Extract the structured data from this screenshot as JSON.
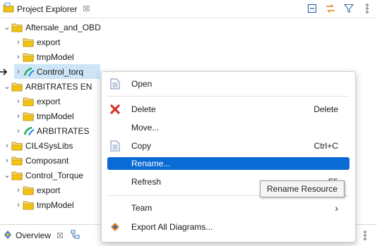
{
  "view": {
    "title": "Project Explorer",
    "close_glyph": "☒",
    "toolbar": [
      "collapse-all-icon",
      "link-with-editor-icon",
      "filter-icon",
      "view-menu-icon"
    ]
  },
  "tree": [
    {
      "label": "Aftersale_and_OBD",
      "level": 0,
      "expanded": true,
      "icon": "project-folder-icon"
    },
    {
      "label": "export",
      "level": 1,
      "expanded": false,
      "icon": "folder-icon"
    },
    {
      "label": "tmpModel",
      "level": 1,
      "expanded": false,
      "icon": "folder-icon"
    },
    {
      "label": "Control_torq",
      "level": 1,
      "expanded": false,
      "icon": "model-icon",
      "selected": true
    },
    {
      "label": "ARBITRATES EN",
      "level": 0,
      "expanded": true,
      "icon": "project-folder-icon"
    },
    {
      "label": "export",
      "level": 1,
      "expanded": false,
      "icon": "folder-icon"
    },
    {
      "label": "tmpModel",
      "level": 1,
      "expanded": false,
      "icon": "folder-icon"
    },
    {
      "label": "ARBITRATES",
      "level": 1,
      "expanded": false,
      "icon": "model-icon"
    },
    {
      "label": "CIL4SysLibs",
      "level": 0,
      "expanded": false,
      "icon": "project-folder-icon"
    },
    {
      "label": "Composant",
      "level": 0,
      "expanded": false,
      "icon": "project-folder-icon"
    },
    {
      "label": "Control_Torque",
      "level": 0,
      "expanded": true,
      "icon": "project-folder-icon"
    },
    {
      "label": "export",
      "level": 1,
      "expanded": false,
      "icon": "folder-icon"
    },
    {
      "label": "tmpModel",
      "level": 1,
      "expanded": false,
      "icon": "folder-icon"
    }
  ],
  "context_menu": {
    "open": {
      "label": "Open",
      "shortcut": ""
    },
    "delete": {
      "label": "Delete",
      "shortcut": "Delete"
    },
    "move": {
      "label": "Move...",
      "shortcut": ""
    },
    "copy": {
      "label": "Copy",
      "shortcut": "Ctrl+C"
    },
    "rename": {
      "label": "Rename...",
      "shortcut": ""
    },
    "refresh": {
      "label": "Refresh",
      "shortcut": "F5"
    },
    "team": {
      "label": "Team",
      "submenu": "›"
    },
    "export_diagrams": {
      "label": "Export All Diagrams...",
      "shortcut": ""
    }
  },
  "tooltip": {
    "text": "Rename Resource"
  },
  "bottom": {
    "tab_title": "Overview",
    "close_glyph": "☒"
  },
  "colors": {
    "selection": "#cde5f7",
    "menu_highlight": "#0b6bd4",
    "folder": "#f1c40f",
    "delete_red": "#d9342b"
  }
}
